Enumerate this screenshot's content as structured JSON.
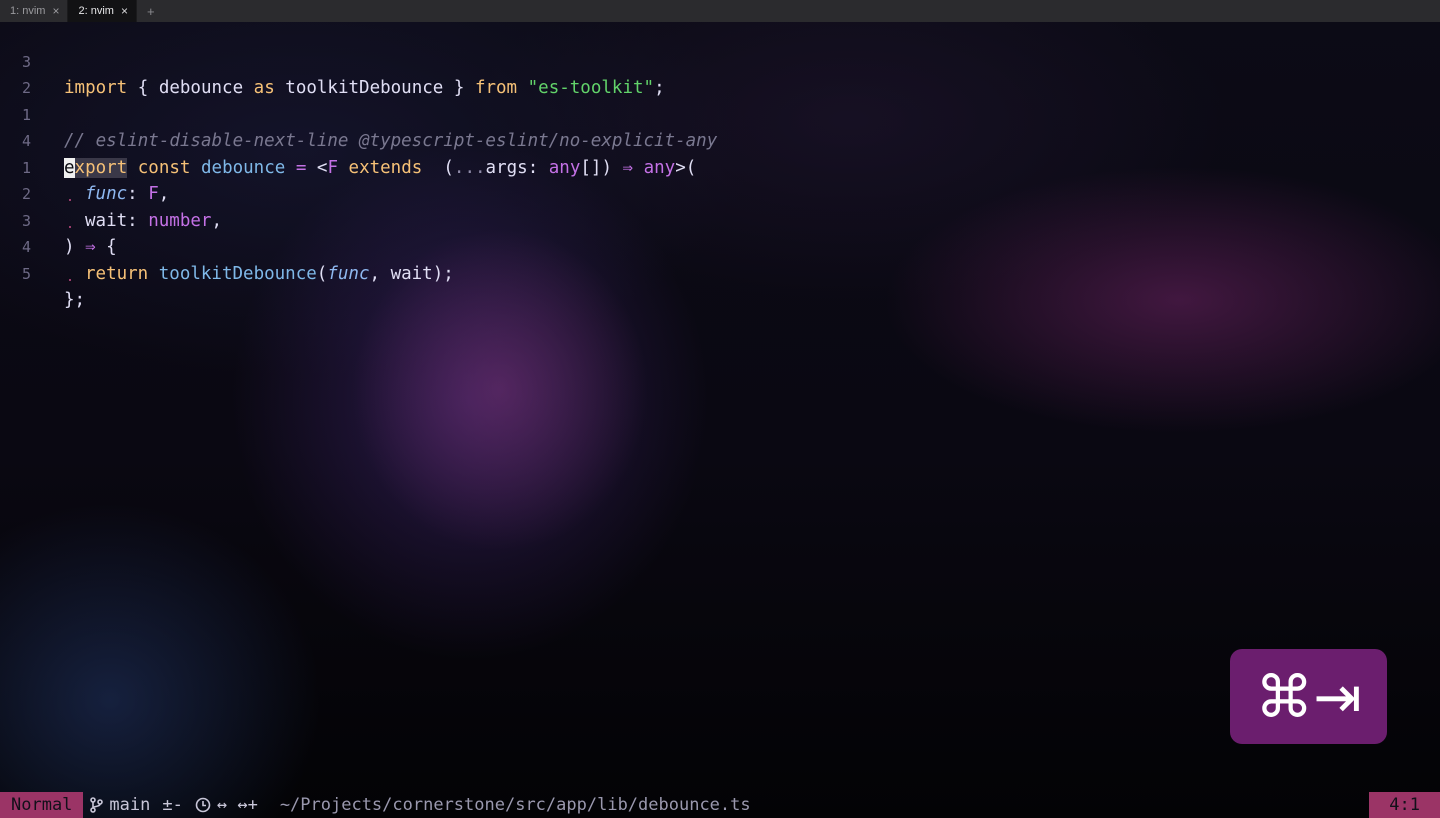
{
  "tabs": [
    {
      "label": "1: nvim",
      "active": false
    },
    {
      "label": "2: nvim",
      "active": true
    }
  ],
  "tab_add_label": "+",
  "tab_close_label": "×",
  "editor": {
    "lines": [
      {
        "num": "3"
      },
      {
        "num": "2"
      },
      {
        "num": "1"
      },
      {
        "num": "4"
      },
      {
        "num": "1"
      },
      {
        "num": "2"
      },
      {
        "num": "3"
      },
      {
        "num": "4"
      },
      {
        "num": "5"
      }
    ],
    "tokens": {
      "import": "import",
      "brace_open": " { ",
      "debounce": "debounce",
      "as": " as ",
      "toolkitDebounce": "toolkitDebounce",
      "brace_close": " } ",
      "from": "from",
      "module": " \"es-toolkit\"",
      "semi": ";",
      "comment": "// eslint-disable-next-line @typescript-eslint/no-explicit-any",
      "export_cursor": "e",
      "export_rest": "xport",
      "const": " const ",
      "debounce_name": "debounce",
      "eq": " = ",
      "lt": "<",
      "F": "F",
      "extends": " extends ",
      "paren_open": "(",
      "spread": "...",
      "args": "args",
      "colon": ": ",
      "any": "any",
      "brackets": "[]",
      "close_paren": ")",
      "arrow": " ⇒ ",
      "any2": "any",
      "gt_paren": ">(",
      "func": "func",
      "F2": "F",
      "comma": ",",
      "wait": "wait",
      "number": "number",
      "close_arrow_paren": ")",
      "arrow2": " ⇒ ",
      "brace_open2": "{",
      "return": "return",
      "toolkit_call": " toolkitDebounce",
      "call_open": "(",
      "func_arg": "func",
      "call_comma": ", ",
      "wait_arg": "wait",
      "call_close": ");",
      "end": "};"
    }
  },
  "keystroke_overlay": {
    "glyphs": "⌘⇥",
    "color": "#6b1e6e"
  },
  "statusline": {
    "mode": "Normal",
    "branch_icon": "git-branch-icon",
    "branch": "main",
    "diff_icon": "diff-icon",
    "diff": "±-",
    "clock_icon": "clock-icon",
    "arrows": "↔ ↔+",
    "path": "~/Projects/cornerstone/src/app/lib/debounce.ts",
    "position": "4:1",
    "accent": "#9b3466"
  }
}
